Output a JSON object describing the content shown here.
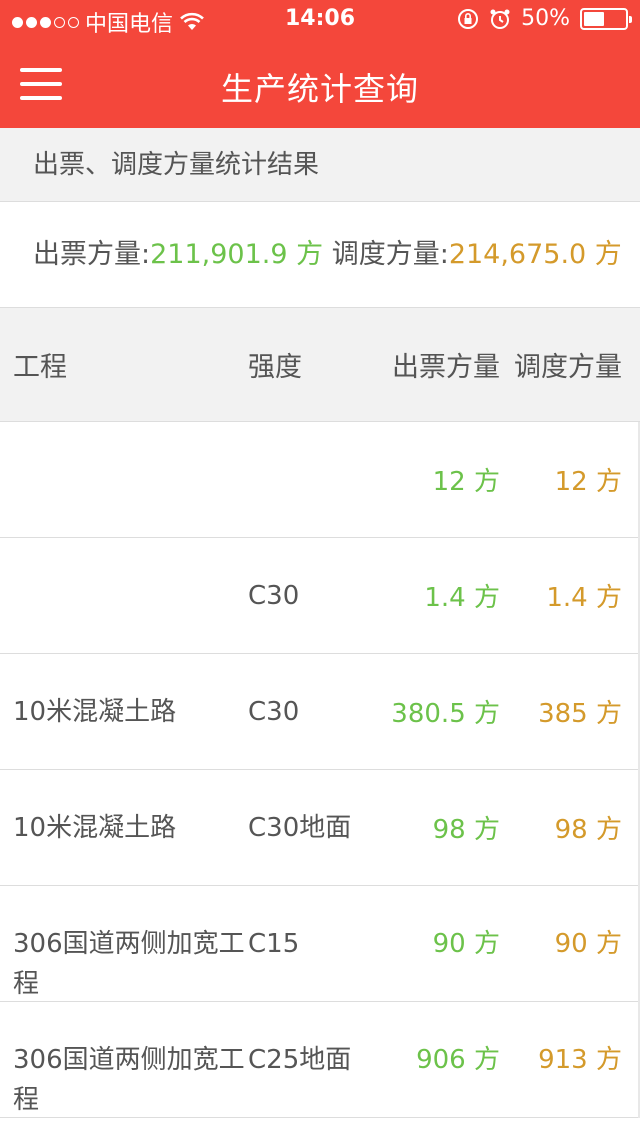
{
  "status_bar": {
    "carrier": "中国电信",
    "time": "14:06",
    "battery_percent": "50%",
    "battery_level": 0.5,
    "signal_strength": 3,
    "signal_max": 5
  },
  "header": {
    "title": "生产统计查询",
    "menu_icon": "hamburger-menu-icon"
  },
  "section": {
    "title": "出票、调度方量统计结果"
  },
  "summary": {
    "ticket_label": "出票方量:",
    "ticket_value": "211,901.9 方",
    "dispatch_label": "调度方量:",
    "dispatch_value": "214,675.0 方"
  },
  "table": {
    "headers": [
      "工程",
      "强度",
      "出票方量",
      "调度方量"
    ],
    "rows": [
      {
        "project": "",
        "strength": "",
        "ticket": "12 方",
        "dispatch": "12 方"
      },
      {
        "project": "",
        "strength": "C30",
        "ticket": "1.4 方",
        "dispatch": "1.4 方"
      },
      {
        "project": "10米混凝土路",
        "strength": "C30",
        "ticket": "380.5 方",
        "dispatch": "385 方"
      },
      {
        "project": "10米混凝土路",
        "strength": "C30地面",
        "ticket": "98 方",
        "dispatch": "98 方"
      },
      {
        "project": "306国道两侧加宽工程",
        "strength": "C15",
        "ticket": "90 方",
        "dispatch": "90 方"
      },
      {
        "project": "306国道两侧加宽工程",
        "strength": "C25地面",
        "ticket": "906 方",
        "dispatch": "913 方"
      }
    ]
  },
  "colors": {
    "accent": "#f4473b",
    "ticket": "#6cc24a",
    "dispatch": "#d49a2b"
  }
}
